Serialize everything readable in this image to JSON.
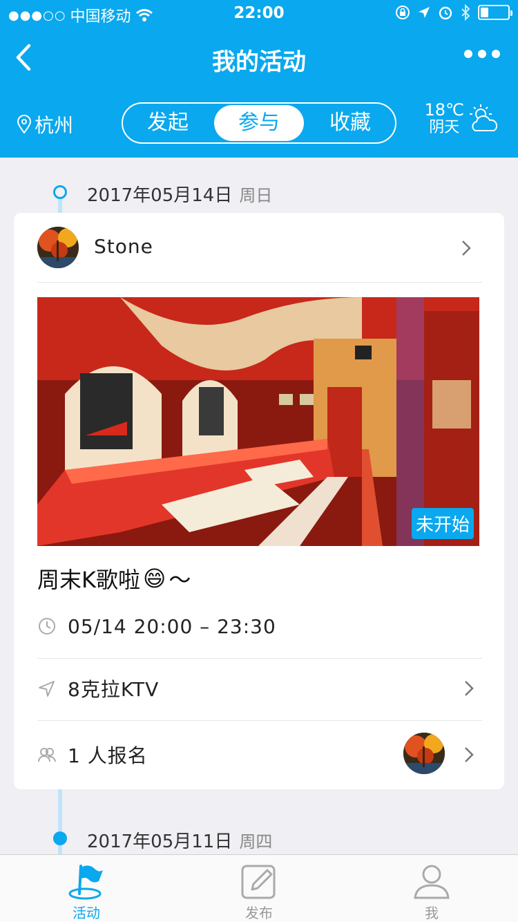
{
  "status_bar": {
    "signal": "●●●○○",
    "carrier": "中国移动",
    "time": "22:00",
    "battery_level": 0.3
  },
  "nav": {
    "title": "我的活动"
  },
  "subbar": {
    "city": "杭州",
    "segments": [
      "发起",
      "参与",
      "收藏"
    ],
    "active_segment": "参与",
    "weather": {
      "temp": "18℃",
      "desc": "阴天"
    }
  },
  "timeline": [
    {
      "date": "2017年05月14日",
      "weekday": "周日"
    },
    {
      "date": "2017年05月11日",
      "weekday": "周四"
    }
  ],
  "card": {
    "user": "Stone",
    "status_badge": "未开始",
    "title": "周末K歌啦",
    "title_emoji": "😄",
    "title_suffix": "～",
    "time": "05/14 20:00 – 23:30",
    "location": "8克拉KTV",
    "signup": "1 人报名"
  },
  "tabbar": {
    "items": [
      "活动",
      "发布",
      "我"
    ],
    "active": "活动"
  },
  "colors": {
    "primary": "#0aa8ee",
    "background": "#efeff4",
    "timeline_line": "#bfe4f8"
  }
}
